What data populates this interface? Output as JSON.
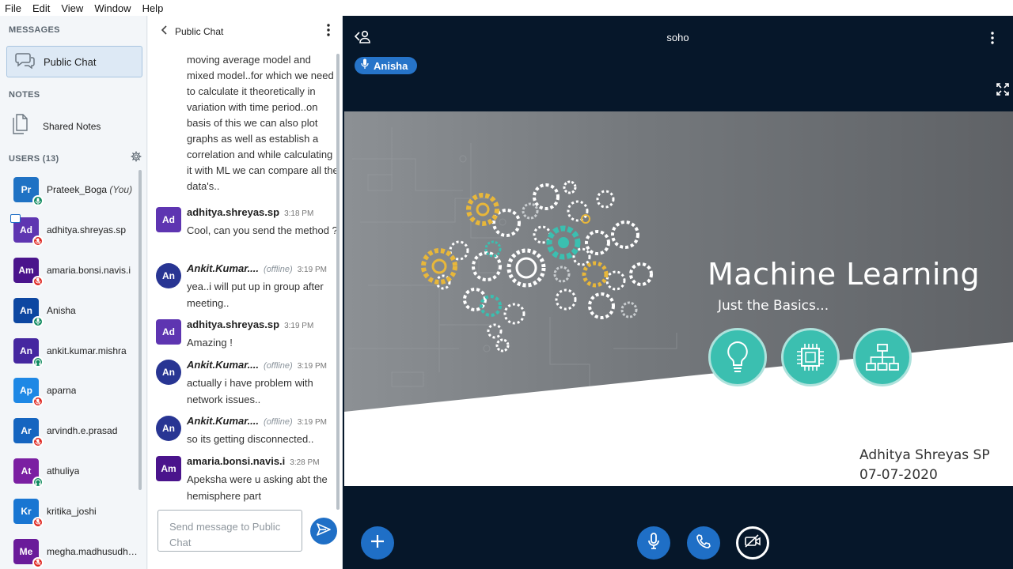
{
  "menubar": {
    "items": [
      "File",
      "Edit",
      "View",
      "Window",
      "Help"
    ]
  },
  "sidebar": {
    "messages_title": "MESSAGES",
    "public_chat_label": "Public Chat",
    "notes_title": "NOTES",
    "shared_notes_label": "Shared Notes",
    "users_title": "USERS (13)",
    "users": [
      {
        "initials": "Pr",
        "name": "Prateek_Boga",
        "suffix": "(You)",
        "color": "#1f72c4",
        "status": "mic-on"
      },
      {
        "initials": "Ad",
        "name": "adhitya.shreyas.sp",
        "color": "#5e35b1",
        "status": "mic-off",
        "presenter": true
      },
      {
        "initials": "Am",
        "name": "amaria.bonsi.navis.i",
        "color": "#4a148c",
        "status": "mic-off"
      },
      {
        "initials": "An",
        "name": "Anisha",
        "color": "#0d47a1",
        "status": "mic-on"
      },
      {
        "initials": "An",
        "name": "ankit.kumar.mishra",
        "color": "#4527a0",
        "status": "listen"
      },
      {
        "initials": "Ap",
        "name": "aparna",
        "color": "#1e88e5",
        "status": "mic-off"
      },
      {
        "initials": "Ar",
        "name": "arvindh.e.prasad",
        "color": "#1565c0",
        "status": "mic-off"
      },
      {
        "initials": "At",
        "name": "athuliya",
        "color": "#7b1fa2",
        "status": "listen"
      },
      {
        "initials": "Kr",
        "name": "kritika_joshi",
        "color": "#1976d2",
        "status": "mic-off"
      },
      {
        "initials": "Me",
        "name": "megha.madhusudh…",
        "color": "#6a1b9a",
        "status": "mic-off"
      }
    ]
  },
  "chat": {
    "title": "Public Chat",
    "continued_text": "moving average model and mixed model..for which we need to calculate it theoretically in variation with time period..on basis of this we can also plot graphs as well as establish a correlation and while calculating it with ML we can compare all the data's..",
    "messages": [
      {
        "initials": "Ad",
        "color": "#5e35b1",
        "round": false,
        "name": "adhitya.shreyas.sp",
        "offline": "",
        "time": "3:18 PM",
        "text": "Cool, can you send the method ?"
      },
      {
        "initials": "An",
        "color": "#283593",
        "round": true,
        "name": "Ankit.Kumar....",
        "offline": "(offline)",
        "time": "3:19 PM",
        "text": "yea..i will put up in group after meeting.."
      },
      {
        "initials": "Ad",
        "color": "#5e35b1",
        "round": false,
        "name": "adhitya.shreyas.sp",
        "offline": "",
        "time": "3:19 PM",
        "text": "Amazing !"
      },
      {
        "initials": "An",
        "color": "#283593",
        "round": true,
        "name": "Ankit.Kumar....",
        "offline": "(offline)",
        "time": "3:19 PM",
        "text": "actually i have problem with network issues.."
      },
      {
        "initials": "An",
        "color": "#283593",
        "round": true,
        "name": "Ankit.Kumar....",
        "offline": "(offline)",
        "time": "3:19 PM",
        "text": "so its getting disconnected.."
      },
      {
        "initials": "Am",
        "color": "#4a148c",
        "round": false,
        "name": "amaria.bonsi.navis.i",
        "offline": "",
        "time": "3:28 PM",
        "text": "Apeksha were u asking abt the hemisphere part"
      }
    ],
    "input_placeholder": "Send message to Public Chat"
  },
  "meeting": {
    "title": "soho",
    "talking": "Anisha",
    "slide": {
      "title": "Machine Learning",
      "subtitle": "Just the Basics...",
      "author": "Adhitya Shreyas SP",
      "date": "07-07-2020"
    }
  },
  "colors": {
    "accent": "#1f6fc6",
    "meeting_bg": "#06172a",
    "teal": "#3bbfb0"
  }
}
